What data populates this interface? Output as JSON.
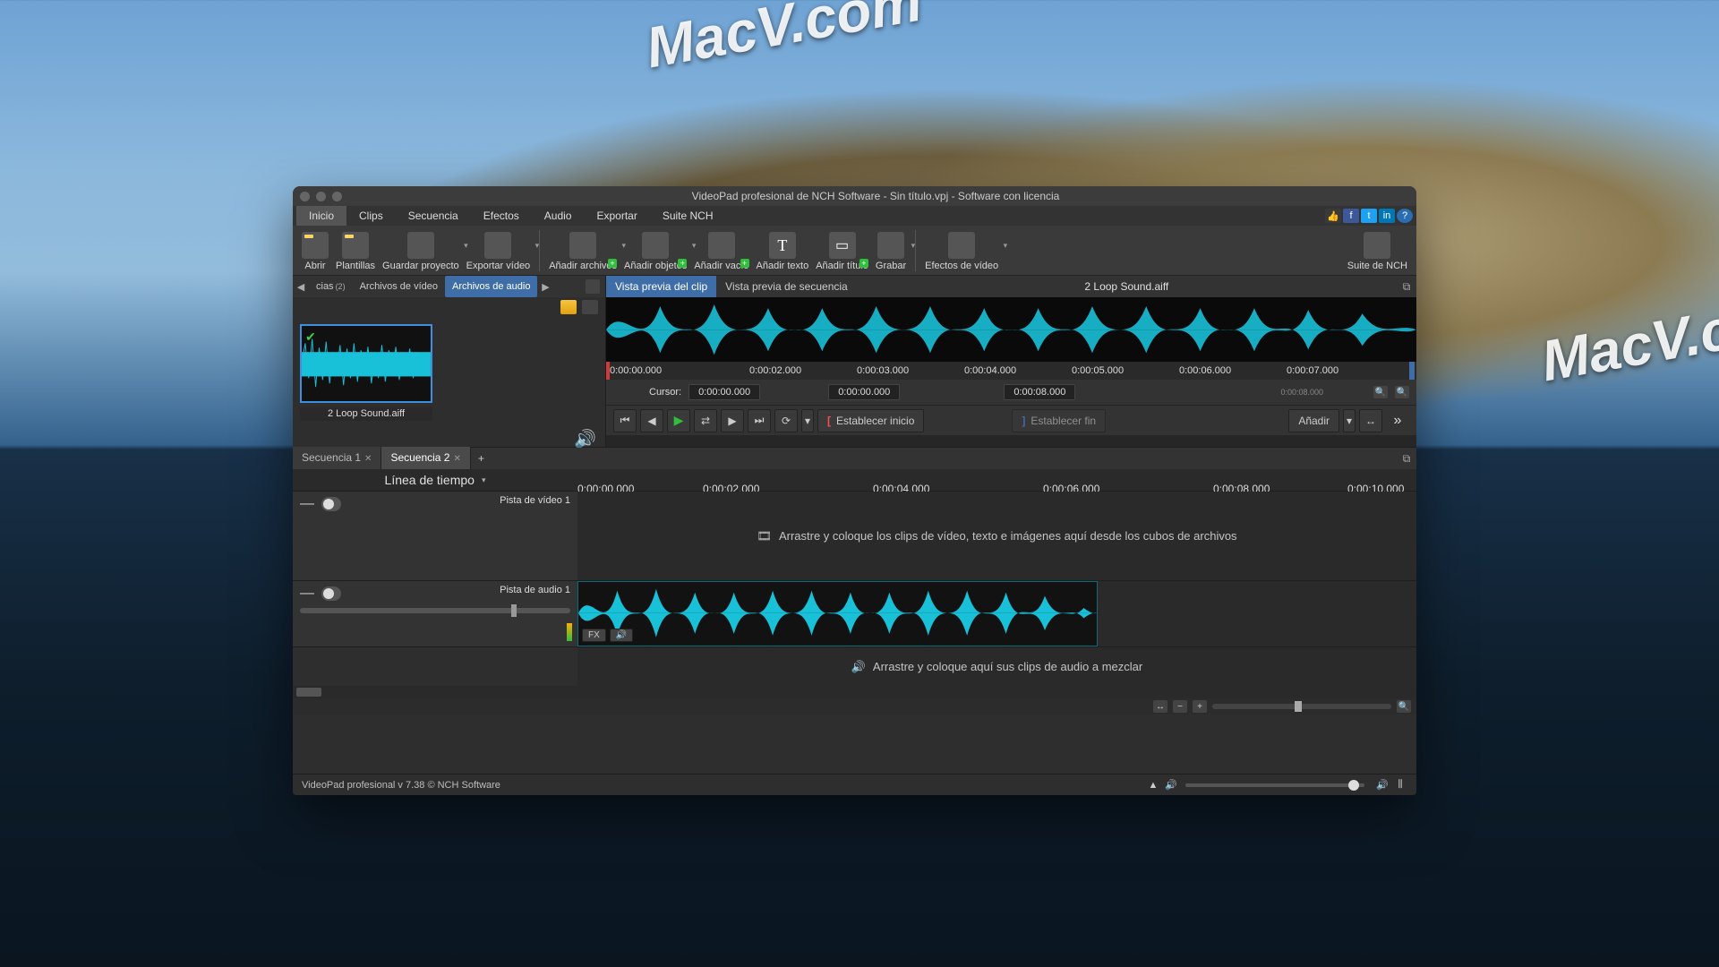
{
  "watermark": "MacV.com",
  "window": {
    "title": "VideoPad profesional de NCH Software - Sin título.vpj - Software con licencia"
  },
  "menu": {
    "items": [
      "Inicio",
      "Clips",
      "Secuencia",
      "Efectos",
      "Audio",
      "Exportar",
      "Suite NCH"
    ],
    "active_index": 0
  },
  "toolbar": {
    "abrir": "Abrir",
    "plantillas": "Plantillas",
    "guardar": "Guardar proyecto",
    "exportar": "Exportar vídeo",
    "add_archivos": "Añadir archivos",
    "add_objetos": "Añadir objetos",
    "add_vacio": "Añadir vacío",
    "add_texto": "Añadir texto",
    "add_titulo": "Añadir título",
    "grabar": "Grabar",
    "efectos": "Efectos de vídeo",
    "suite": "Suite de NCH"
  },
  "bin": {
    "tab_cias": "cias",
    "tab_cias_count": "(2)",
    "tab_video": "Archivos de vídeo",
    "tab_audio": "Archivos de audio",
    "clip_name": "2 Loop Sound.aiff"
  },
  "preview": {
    "tab_clip": "Vista previa del clip",
    "tab_seq": "Vista previa de secuencia",
    "filename": "2 Loop Sound.aiff",
    "ruler": [
      "0:00:00.000",
      "0:00:02.000",
      "0:00:03.000",
      "0:00:04.000",
      "0:00:05.000",
      "0:00:06.000",
      "0:00:07.000"
    ],
    "cursor_label": "Cursor:",
    "cursor_time": "0:00:00.000",
    "sel_time": "0:00:00.000",
    "dur_time": "0:00:08.000",
    "dur_mini": "0:00:08.000",
    "set_in": "Establecer inicio",
    "set_out": "Establecer fin",
    "anadir": "Añadir"
  },
  "sequence": {
    "tab1": "Secuencia 1",
    "tab2": "Secuencia 2",
    "timeline_label": "Línea de tiempo",
    "ruler": [
      "0:00:00.000",
      "0:00:02.000",
      "0:00:04.000",
      "0:00:06.000",
      "0:00:08.000",
      "0:00:10.000"
    ],
    "video_track": "Pista de vídeo 1",
    "audio_track": "Pista de audio 1",
    "video_hint": "Arrastre y coloque los clips de vídeo, texto e imágenes aquí desde los cubos de archivos",
    "audio_hint": "Arrastre y coloque aquí sus clips de audio a mezclar",
    "fx": "FX"
  },
  "status": {
    "text": "VideoPad profesional v 7.38 © NCH Software"
  },
  "colors": {
    "waveform": "#18c0d8",
    "accent": "#3e6da8"
  }
}
